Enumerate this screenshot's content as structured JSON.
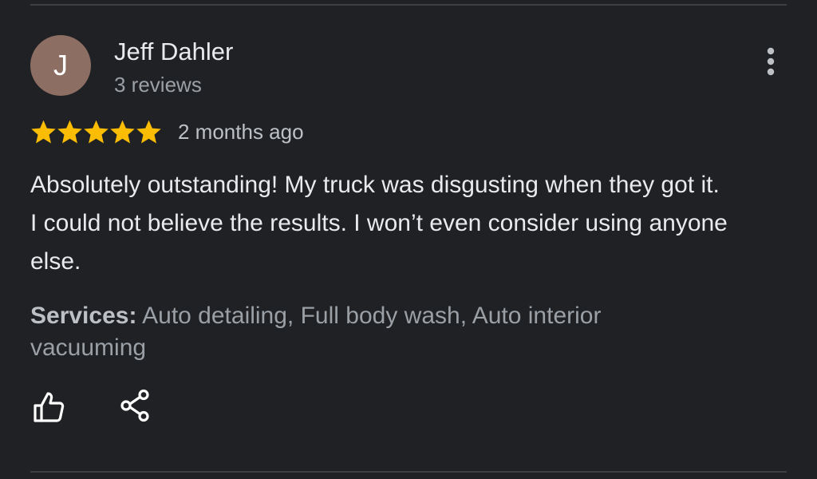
{
  "reviewer": {
    "initial": "J",
    "name": "Jeff Dahler",
    "meta": "3 reviews",
    "avatar_color": "#8d6e63"
  },
  "review": {
    "rating": 5,
    "max_rating": 5,
    "date": "2 months ago",
    "text": "Absolutely outstanding!  My truck was disgusting when they got it. I could not believe the results. I won’t even consider using anyone else.",
    "services_label": "Services:",
    "services_value": "Auto detailing, Full body wash, Auto interior vacuuming"
  },
  "actions": {
    "like_icon": "thumbs-up-icon",
    "share_icon": "share-icon",
    "more_icon": "more-vertical-icon"
  },
  "colors": {
    "background": "#202124",
    "star": "#fbbc04",
    "text_primary": "#e8eaed",
    "text_secondary": "#9aa0a6"
  }
}
